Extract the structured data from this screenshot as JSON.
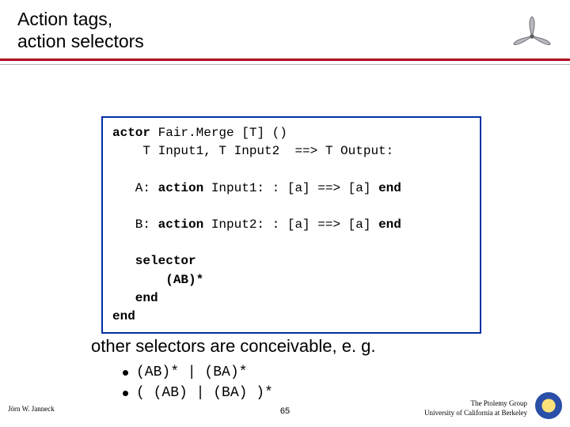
{
  "title": {
    "line1": "Action tags,",
    "line2": "action selectors"
  },
  "code": {
    "l1_a": "actor",
    "l1_b": " Fair.Merge [T] ()",
    "l2": "    T Input1, T Input2  ==> T Output:",
    "blank": "",
    "l3_a": "   A: ",
    "l3_b": "action",
    "l3_c": " Input1: : [a] ==> [a] ",
    "l3_d": "end",
    "l4_a": "   B: ",
    "l4_b": "action",
    "l4_c": " Input2: : [a] ==> [a] ",
    "l4_d": "end",
    "l5": "   selector",
    "l6": "       (AB)*",
    "l7": "   end",
    "l8": "end"
  },
  "body_text": "other selectors are conceivable, e. g.",
  "bullets": {
    "b1": "(AB)* | (BA)*",
    "b2": "( (AB) | (BA) )*"
  },
  "footer": {
    "left": "Jörn W. Janneck",
    "center": "65",
    "right_line1": "The Ptolemy Group",
    "right_line2": "University of California at Berkeley"
  }
}
